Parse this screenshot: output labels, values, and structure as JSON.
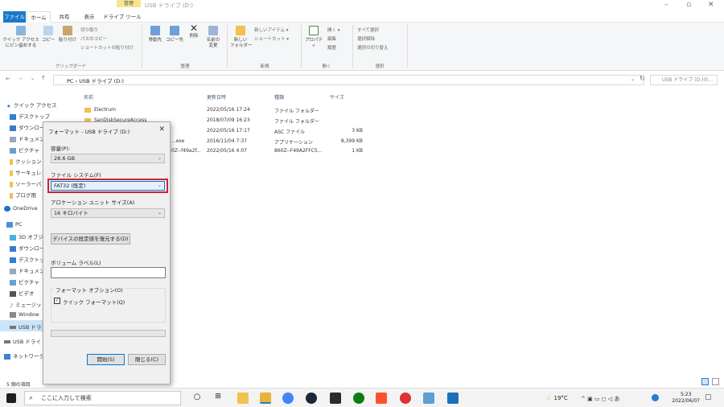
{
  "window": {
    "title": "USB ドライブ (D:)",
    "manage_tab": "管理"
  },
  "ribbon_tabs": [
    "ファイル",
    "ホーム",
    "共有",
    "表示",
    "ドライブ ツール"
  ],
  "ribbon": {
    "pin_label": "クイック アクセス\nにピン留めする",
    "copy": "コピー",
    "paste": "貼り付け",
    "cut": "切り取り",
    "copy_path": "パスのコピー",
    "paste_shortcut": "ショートカットの貼り付け",
    "move_to": "移動先",
    "copy_to": "コピー先",
    "delete": "削除",
    "rename": "名前の\n変更",
    "new_folder": "新しい\nフォルダー",
    "new_item": "新しいアイテム ▾",
    "shortcut": "ショートカット ▾",
    "properties": "プロパティ",
    "open": "開く ▾",
    "edit": "編集",
    "history": "履歴",
    "select_all": "すべて選択",
    "select_none": "選択解除",
    "invert": "選択の切り替え",
    "groups": [
      "クリップボード",
      "整理",
      "新規",
      "開く",
      "選択"
    ]
  },
  "address": {
    "path": "PC  ›  USB ドライブ (D:)",
    "search_placeholder": "USB ドライブ (D:)の..."
  },
  "nav": [
    "クイック アクセス",
    "デスクトップ",
    "ダウンロー",
    "ドキュメン",
    "ピクチャ",
    "クッション",
    "サーキュレ",
    "ソーラーパ",
    "ブログ用",
    "OneDrive",
    "PC",
    "3D オブジ",
    "ダウンロー",
    "デスクトッ",
    "ドキュメン",
    "ピクチャ",
    "ビデオ",
    "ミュージッ",
    "Window",
    "USB ドラ",
    "USB ドライ",
    "ネットワーク"
  ],
  "columns": {
    "name": "名前",
    "date": "更新日時",
    "type": "種類",
    "size": "サイズ"
  },
  "files": [
    {
      "name": "Electrum",
      "date": "2022/05/16 17:24",
      "type": "ファイル フォルダー",
      "size": ""
    },
    {
      "name": "SanDiskSecureAccess",
      "date": "2018/07/09 16:23",
      "type": "ファイル フォルダー",
      "size": ""
    },
    {
      "name": "",
      "date": "2022/05/16 17:17",
      "type": "ASC ファイル",
      "size": "3 KB"
    },
    {
      "name": "...exe",
      "date": "2016/11/04 7:37",
      "type": "アプリケーション",
      "size": "8,399 KB"
    },
    {
      "name": "0Z--f49a2f...",
      "date": "2022/05/16 4:07",
      "type": "860Z--F49A2FFC5...",
      "size": "1 KB"
    }
  ],
  "status": "5 個の項目",
  "dialog": {
    "title": "フォーマット - USB ドライブ (D:)",
    "capacity_label": "容量(P):",
    "capacity": "28.6 GB",
    "fs_label": "ファイル システム(F)",
    "fs": "FAT32 (既定)",
    "alloc_label": "アロケーション ユニット サイズ(A)",
    "alloc": "16 キロバイト",
    "restore": "デバイスの既定値を復元する(D)",
    "volume_label": "ボリューム ラベル(L)",
    "options_label": "フォーマット オプション(O)",
    "quick": "クイック フォーマット(Q)",
    "start": "開始(S)",
    "close": "閉じる(C)"
  },
  "taskbar": {
    "search": "ここに入力して検索",
    "weather": "19°C",
    "time": "5:23",
    "date": "2022/06/07"
  }
}
